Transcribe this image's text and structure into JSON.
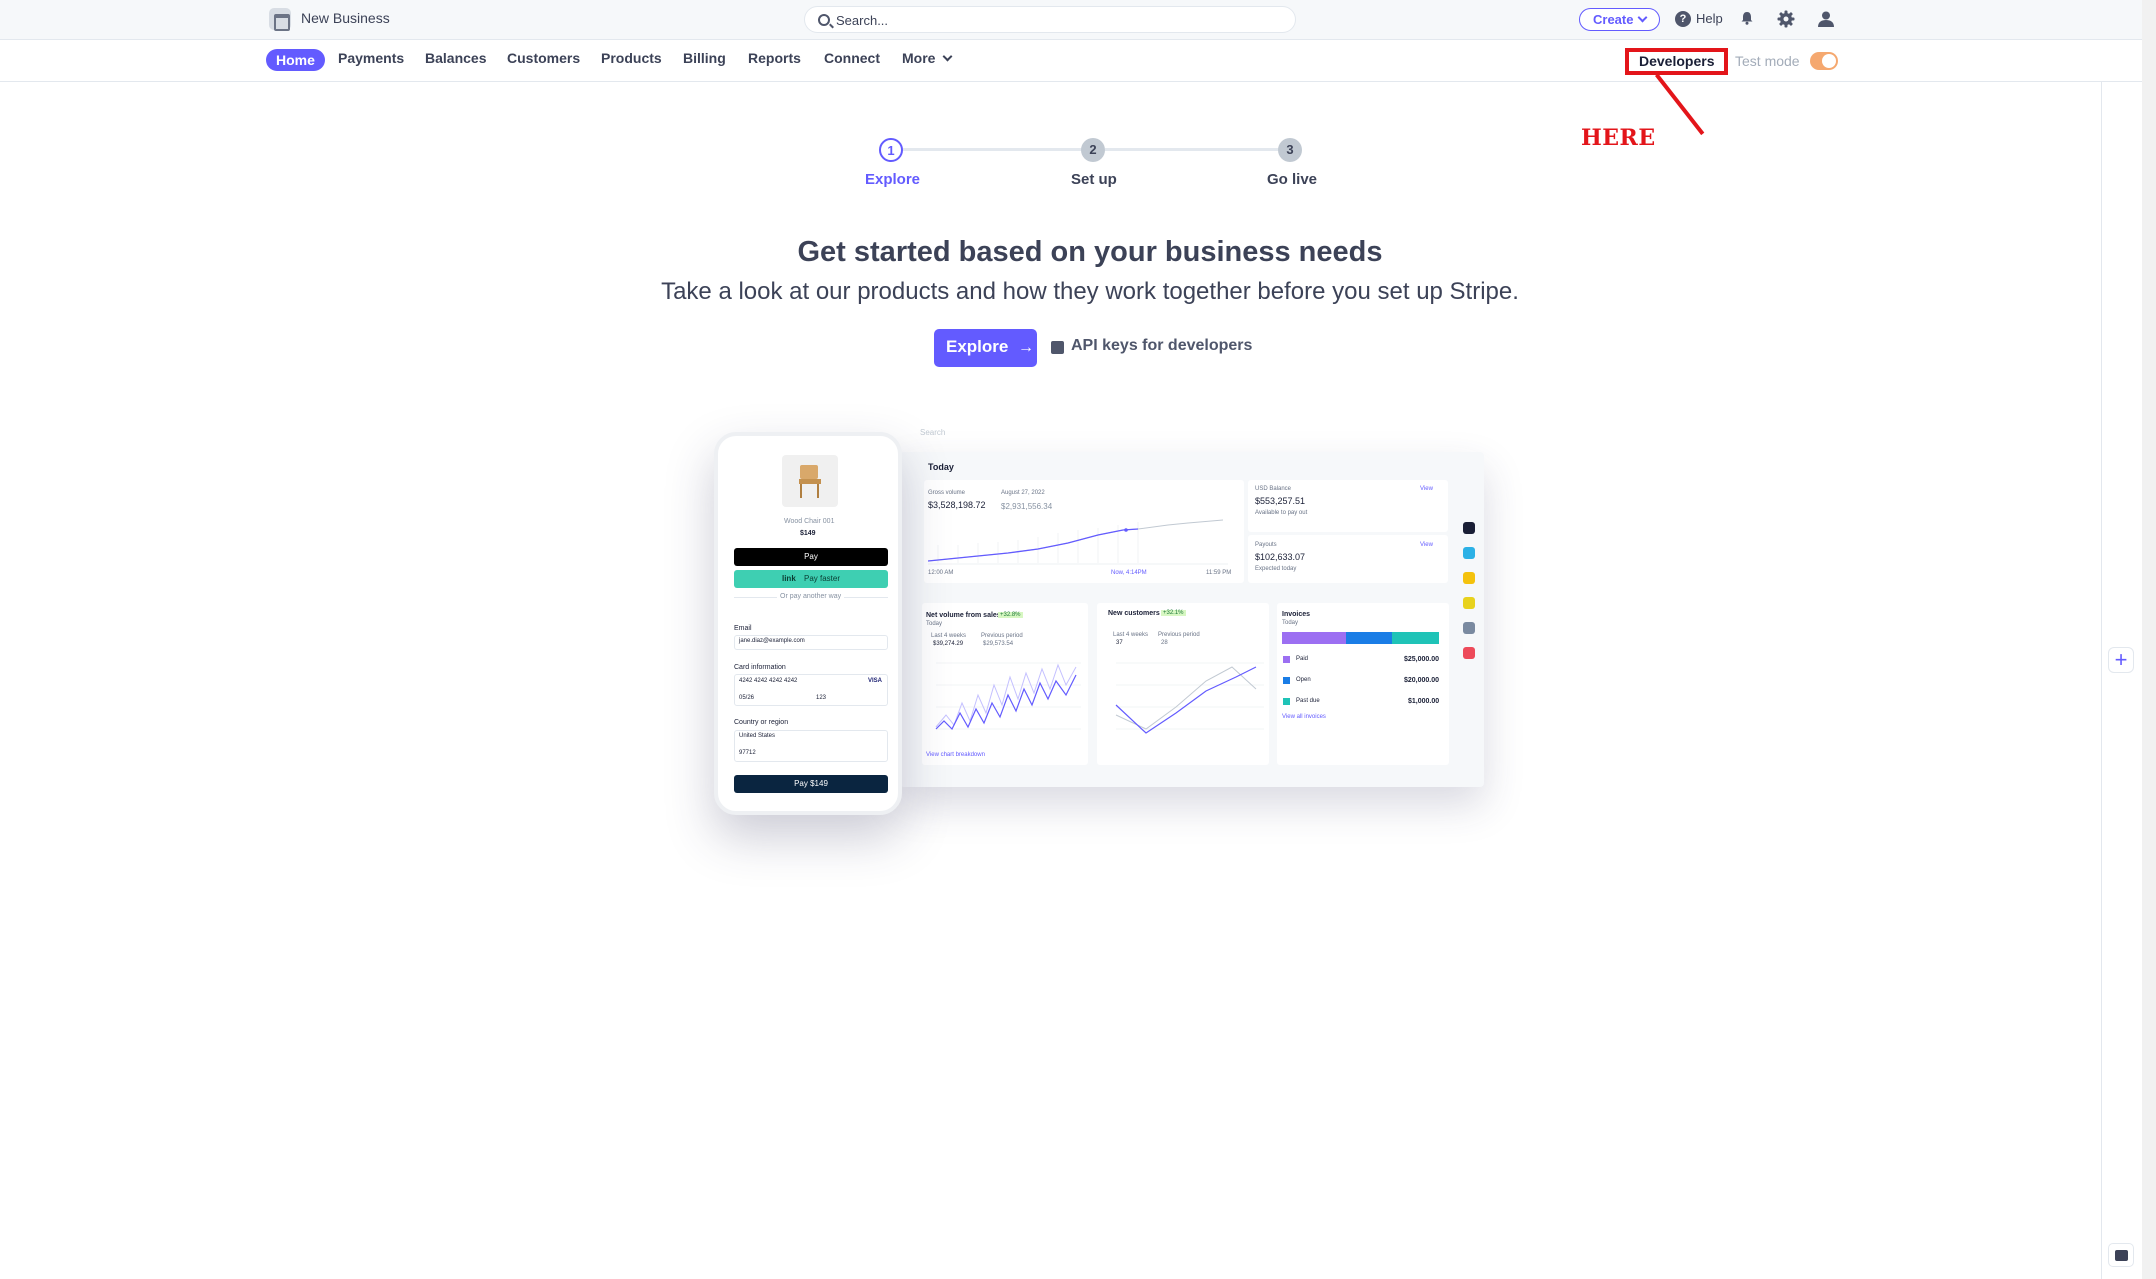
{
  "topbar": {
    "business_name": "New Business",
    "search_placeholder": "Search...",
    "create_label": "Create",
    "help_label": "Help"
  },
  "nav": {
    "items": [
      {
        "label": "Home",
        "active": true
      },
      {
        "label": "Payments"
      },
      {
        "label": "Balances"
      },
      {
        "label": "Customers"
      },
      {
        "label": "Products"
      },
      {
        "label": "Billing"
      },
      {
        "label": "Reports"
      },
      {
        "label": "Connect"
      },
      {
        "label": "More"
      }
    ],
    "developers_label": "Developers",
    "test_mode_label": "Test mode",
    "test_mode_on": true
  },
  "annotation": {
    "text": "HERE",
    "color": "#e3151a"
  },
  "stepper": {
    "steps": [
      {
        "number": "1",
        "label": "Explore",
        "active": true
      },
      {
        "number": "2",
        "label": "Set up"
      },
      {
        "number": "3",
        "label": "Go live"
      }
    ]
  },
  "hero": {
    "title": "Get started based on your business needs",
    "subtitle": "Take a look at our products and how they work together before you set up Stripe.",
    "explore_label": "Explore",
    "api_link_label": "API keys for developers"
  },
  "illustration": {
    "dashboard": {
      "search": "Search",
      "today": "Today",
      "gross_volume_label": "Gross volume",
      "gross_volume": "$3,528,198.72",
      "compare_date": "August 27, 2022",
      "compare_value": "$2,931,556.34",
      "time_start": "12:00 AM",
      "time_now": "Now, 4:14PM",
      "time_end": "11:59 PM",
      "usd_balance_label": "USD Balance",
      "usd_balance": "$553,257.51",
      "available_label": "Available to pay out",
      "payouts_label": "Payouts",
      "payouts": "$102,633.07",
      "expected_label": "Expected today",
      "view_label": "View",
      "net_volume_label": "Net volume from sales",
      "net_volume_badge": "+32.8%",
      "net_last": "$39,274.29",
      "net_prev": "$29,573.54",
      "new_customers_label": "New customers",
      "new_customers_badge": "+32.1%",
      "cust_last": "37",
      "cust_prev": "28",
      "invoices_label": "Invoices",
      "paid_label": "Paid",
      "paid_value": "$25,000.00",
      "open_label": "Open",
      "open_value": "$20,000.00",
      "past_due_label": "Past due",
      "past_due_value": "$1,000.00",
      "view_all_invoices": "View all invoices",
      "view_breakdown": "View chart breakdown",
      "last_4_weeks": "Last 4 weeks",
      "previous_period": "Previous period",
      "today_small": "Today"
    },
    "phone": {
      "product_name": "Wood Chair 001",
      "price": "$149",
      "apple_pay": "Pay",
      "link_label": "link",
      "pay_faster": "Pay faster",
      "or_pay": "Or pay another way",
      "email_label": "Email",
      "email_value": "jane.diaz@example.com",
      "card_label": "Card information",
      "card_number": "4242 4242 4242 4242",
      "card_brand": "VISA",
      "expiry": "05/26",
      "cvc": "123",
      "country_label": "Country or region",
      "country": "United States",
      "zip": "97712",
      "pay_button": "Pay $149"
    }
  },
  "colors": {
    "brand": "#635bff",
    "toggle": "#f5a86f",
    "teal": "#3ecfb2"
  }
}
